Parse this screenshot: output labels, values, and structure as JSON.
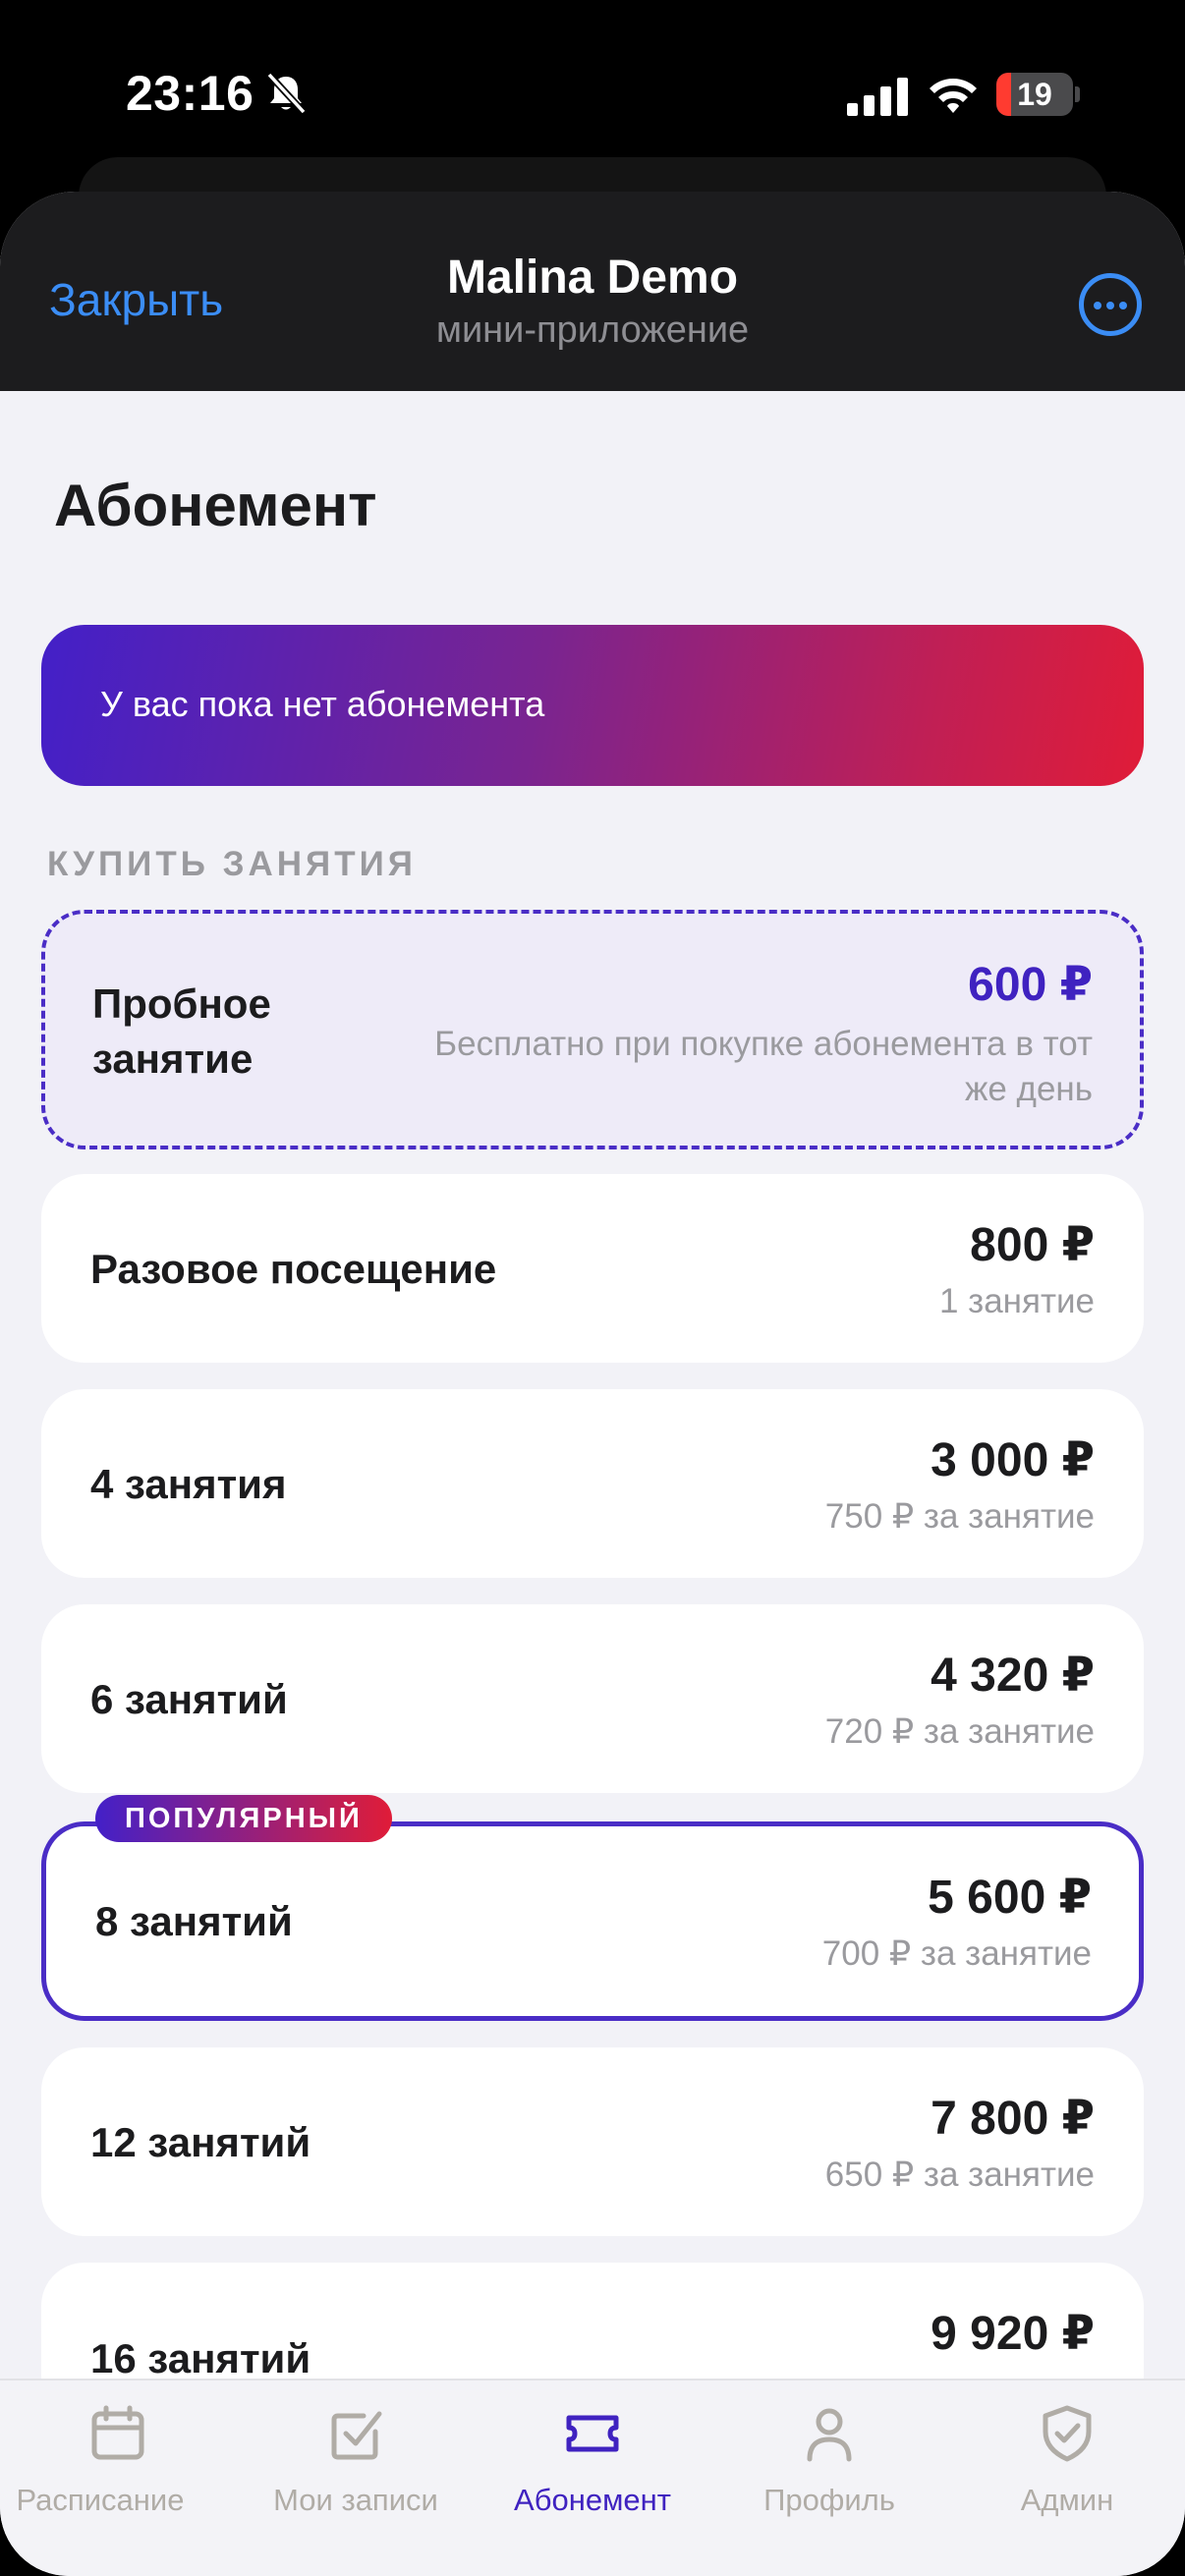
{
  "status_bar": {
    "time": "23:16",
    "battery_level": 0.19,
    "battery_text": "19"
  },
  "header": {
    "close_label": "Закрыть",
    "title": "Malina Demo",
    "subtitle": "мини-приложение"
  },
  "page": {
    "title": "Абонемент",
    "banner_text": "У вас пока нет абонемента",
    "section_label": "КУПИТЬ ЗАНЯТИЯ"
  },
  "plans": [
    {
      "name": "Пробное занятие",
      "price": "600 ₽",
      "note": "Бесплатно при покупке абонемента в тот же день"
    },
    {
      "name": "Разовое посещение",
      "price": "800 ₽",
      "note": "1 занятие"
    },
    {
      "name": "4 занятия",
      "price": "3 000 ₽",
      "note": "750 ₽ за занятие"
    },
    {
      "name": "6 занятий",
      "price": "4 320 ₽",
      "note": "720 ₽ за занятие"
    },
    {
      "name": "8 занятий",
      "price": "5 600 ₽",
      "note": "700 ₽ за занятие",
      "badge": "ПОПУЛЯРНЫЙ"
    },
    {
      "name": "12 занятий",
      "price": "7 800 ₽",
      "note": "650 ₽ за занятие"
    },
    {
      "name": "16 занятий",
      "price": "9 920 ₽"
    }
  ],
  "tabs": [
    {
      "label": "Расписание",
      "icon": "calendar-icon"
    },
    {
      "label": "Мои записи",
      "icon": "checkbox-icon"
    },
    {
      "label": "Абонемент",
      "icon": "ticket-icon",
      "active": true
    },
    {
      "label": "Профиль",
      "icon": "person-icon"
    },
    {
      "label": "Админ",
      "icon": "shield-check-icon"
    }
  ],
  "colors": {
    "accent": "#3f22c0",
    "link": "#3b8df5",
    "gradient_start": "#4320c8",
    "gradient_end": "#e01c38"
  }
}
